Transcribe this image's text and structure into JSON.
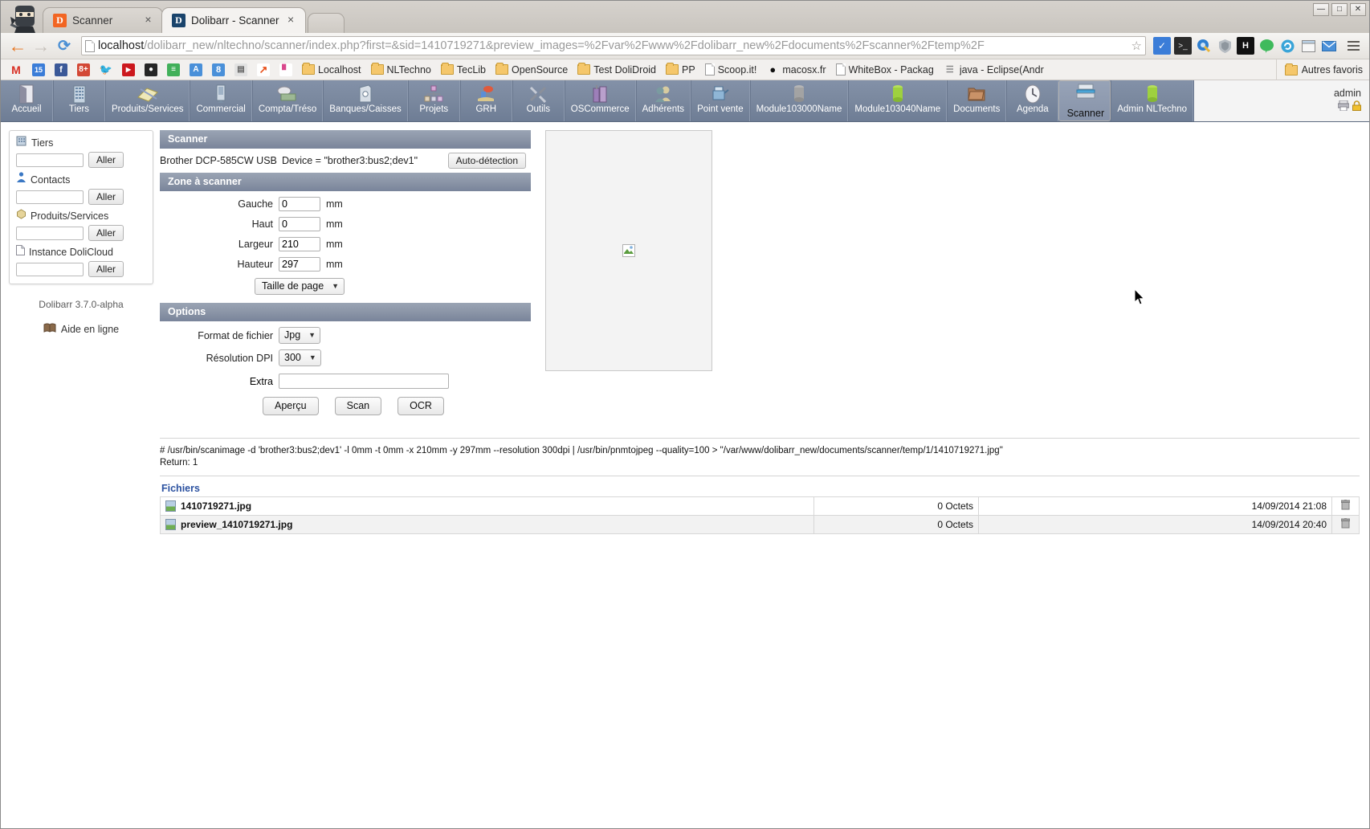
{
  "browser": {
    "tabs": [
      {
        "title": "Scanner",
        "favicon": "dolibarr-orange-icon",
        "active": false
      },
      {
        "title": "Dolibarr - Scanner",
        "favicon": "dolibarr-blue-icon",
        "active": true
      }
    ],
    "new_tab_label": "",
    "window_controls": {
      "minimize": "—",
      "maximize": "□",
      "close": "✕"
    },
    "nav": {
      "back": "←",
      "forward": "→",
      "reload": "⟳"
    },
    "url": {
      "host": "localhost",
      "path": "/dolibarr_new/nltechno/scanner/index.php?first=&sid=1410719271&preview_images=%2Fvar%2Fwww%2Fdolibarr_new%2Fdocuments%2Fscanner%2Ftemp%2F",
      "star": "☆"
    },
    "extensions": [
      "checkmark-extension-icon",
      "terminal-extension-icon",
      "globe-key-extension-icon",
      "shield-extension-icon",
      "h-extension-icon",
      "hangouts-extension-icon",
      "refresh-circle-extension-icon",
      "window-extension-icon",
      "mail-extension-icon"
    ],
    "menu": "hamburger-menu-icon",
    "bookmarks": [
      {
        "label": "",
        "icon": "gmail-icon",
        "glyph": "M",
        "color": "#d93025",
        "bg": "transparent"
      },
      {
        "label": "",
        "icon": "calendar-icon",
        "glyph": "15",
        "color": "#ffffff",
        "bg": "#3b7dd8"
      },
      {
        "label": "",
        "icon": "facebook-icon",
        "glyph": "f",
        "color": "#ffffff",
        "bg": "#3b5998"
      },
      {
        "label": "",
        "icon": "google-plus-icon",
        "glyph": "8+",
        "color": "#ffffff",
        "bg": "#d34836"
      },
      {
        "label": "",
        "icon": "twitter-icon",
        "glyph": "t",
        "color": "#ffffff",
        "bg": "#55acee"
      },
      {
        "label": "",
        "icon": "youtube-icon",
        "glyph": "▶",
        "color": "#ffffff",
        "bg": "#cc181e"
      },
      {
        "label": "",
        "icon": "owl-icon",
        "glyph": "●",
        "color": "#ffffff",
        "bg": "#262626"
      },
      {
        "label": "",
        "icon": "notes-icon",
        "glyph": "≡",
        "color": "#ffffff",
        "bg": "#41b05a"
      },
      {
        "label": "",
        "icon": "translate-icon",
        "glyph": "A",
        "color": "#ffffff",
        "bg": "#4a90d9"
      },
      {
        "label": "",
        "icon": "google-search-icon",
        "glyph": "8",
        "color": "#ffffff",
        "bg": "#4a90d9"
      },
      {
        "label": "",
        "icon": "news-icon",
        "glyph": "▤",
        "color": "#555555",
        "bg": "#e2e2e2"
      },
      {
        "label": "",
        "icon": "analytics-icon",
        "glyph": "↗",
        "color": "#e8501a",
        "bg": "#ffffff"
      },
      {
        "label": "",
        "icon": "bar-chart-icon",
        "glyph": "▐",
        "color": "#d9478c",
        "bg": "#ffffff"
      },
      {
        "label": "Localhost",
        "icon": "folder-icon"
      },
      {
        "label": "NLTechno",
        "icon": "folder-icon"
      },
      {
        "label": "TecLib",
        "icon": "folder-icon"
      },
      {
        "label": "OpenSource",
        "icon": "folder-icon"
      },
      {
        "label": "Test DoliDroid",
        "icon": "folder-icon"
      },
      {
        "label": "PP",
        "icon": "folder-icon"
      },
      {
        "label": "Scoop.it!",
        "icon": "page-icon"
      },
      {
        "label": "macosx.fr",
        "icon": "macosx-icon"
      },
      {
        "label": "WhiteBox - Packag",
        "icon": "page-icon"
      },
      {
        "label": "java - Eclipse(Andr",
        "icon": "java-icon"
      }
    ],
    "other_bookmarks": {
      "label": "Autres favoris",
      "icon": "folder-icon"
    }
  },
  "dolibarr": {
    "topmenu": [
      {
        "label": "Accueil",
        "icon": "home-icon",
        "selected": false
      },
      {
        "label": "Tiers",
        "icon": "company-icon",
        "selected": false
      },
      {
        "label": "Produits/Services",
        "icon": "products-icon",
        "selected": false
      },
      {
        "label": "Commercial",
        "icon": "commercial-icon",
        "selected": false
      },
      {
        "label": "Compta/Tréso",
        "icon": "accounting-icon",
        "selected": false
      },
      {
        "label": "Banques/Caisses",
        "icon": "bank-icon",
        "selected": false
      },
      {
        "label": "Projets",
        "icon": "projects-icon",
        "selected": false
      },
      {
        "label": "GRH",
        "icon": "hr-icon",
        "selected": false
      },
      {
        "label": "Outils",
        "icon": "tools-icon",
        "selected": false
      },
      {
        "label": "OSCommerce",
        "icon": "oscommerce-icon",
        "selected": false
      },
      {
        "label": "Adhérents",
        "icon": "members-icon",
        "selected": false
      },
      {
        "label": "Point vente",
        "icon": "pos-icon",
        "selected": false
      },
      {
        "label": "Module103000Name",
        "icon": "module-grey-icon",
        "selected": false
      },
      {
        "label": "Module103040Name",
        "icon": "module-green-icon",
        "selected": false
      },
      {
        "label": "Documents",
        "icon": "documents-icon",
        "selected": false
      },
      {
        "label": "Agenda",
        "icon": "clock-icon",
        "selected": false
      },
      {
        "label": "Scanner",
        "icon": "scanner-icon",
        "selected": true
      },
      {
        "label": "Admin NLTechno",
        "icon": "module-green-icon",
        "selected": false
      }
    ],
    "user": {
      "name": "admin",
      "icons": [
        "printer-icon",
        "lock-icon"
      ]
    },
    "sidebar": {
      "search_groups": [
        {
          "label": "Tiers",
          "icon": "company-small-icon",
          "value": "",
          "button": "Aller"
        },
        {
          "label": "Contacts",
          "icon": "contact-small-icon",
          "value": "",
          "button": "Aller"
        },
        {
          "label": "Produits/Services",
          "icon": "product-small-icon",
          "value": "",
          "button": "Aller"
        },
        {
          "label": "Instance DoliCloud",
          "icon": "page-small-icon",
          "value": "",
          "button": "Aller"
        }
      ],
      "version": "Dolibarr 3.7.0-alpha",
      "help": {
        "label": "Aide en ligne",
        "icon": "book-icon"
      }
    },
    "scanner": {
      "section_scanner": "Scanner",
      "device_name": "Brother DCP-585CW USB",
      "device_string": "Device = \"brother3:bus2;dev1\"",
      "autodetect_button": "Auto-détection",
      "section_zone": "Zone à scanner",
      "fields": [
        {
          "label": "Gauche",
          "value": "0",
          "unit": "mm"
        },
        {
          "label": "Haut",
          "value": "0",
          "unit": "mm"
        },
        {
          "label": "Largeur",
          "value": "210",
          "unit": "mm"
        },
        {
          "label": "Hauteur",
          "value": "297",
          "unit": "mm"
        }
      ],
      "page_size_select": "Taille de page",
      "section_options": "Options",
      "file_format": {
        "label": "Format de fichier",
        "value": "Jpg"
      },
      "resolution": {
        "label": "Résolution DPI",
        "value": "300"
      },
      "extra": {
        "label": "Extra",
        "value": ""
      },
      "buttons": {
        "preview": "Aperçu",
        "scan": "Scan",
        "ocr": "OCR"
      },
      "preview_placeholder": "broken-image-icon"
    },
    "output": {
      "command": "# /usr/bin/scanimage -d 'brother3:bus2;dev1' -l 0mm -t 0mm -x 210mm -y 297mm --resolution 300dpi | /usr/bin/pnmtojpeg --quality=100 > \"/var/www/dolibarr_new/documents/scanner/temp/1/1410719271.jpg\"",
      "return": "Return: 1"
    },
    "files": {
      "title": "Fichiers",
      "rows": [
        {
          "name": "1410719271.jpg",
          "size": "0 Octets",
          "date": "14/09/2014 21:08",
          "action": "delete-icon"
        },
        {
          "name": "preview_1410719271.jpg",
          "size": "0 Octets",
          "date": "14/09/2014 20:40",
          "action": "delete-icon"
        }
      ]
    }
  }
}
